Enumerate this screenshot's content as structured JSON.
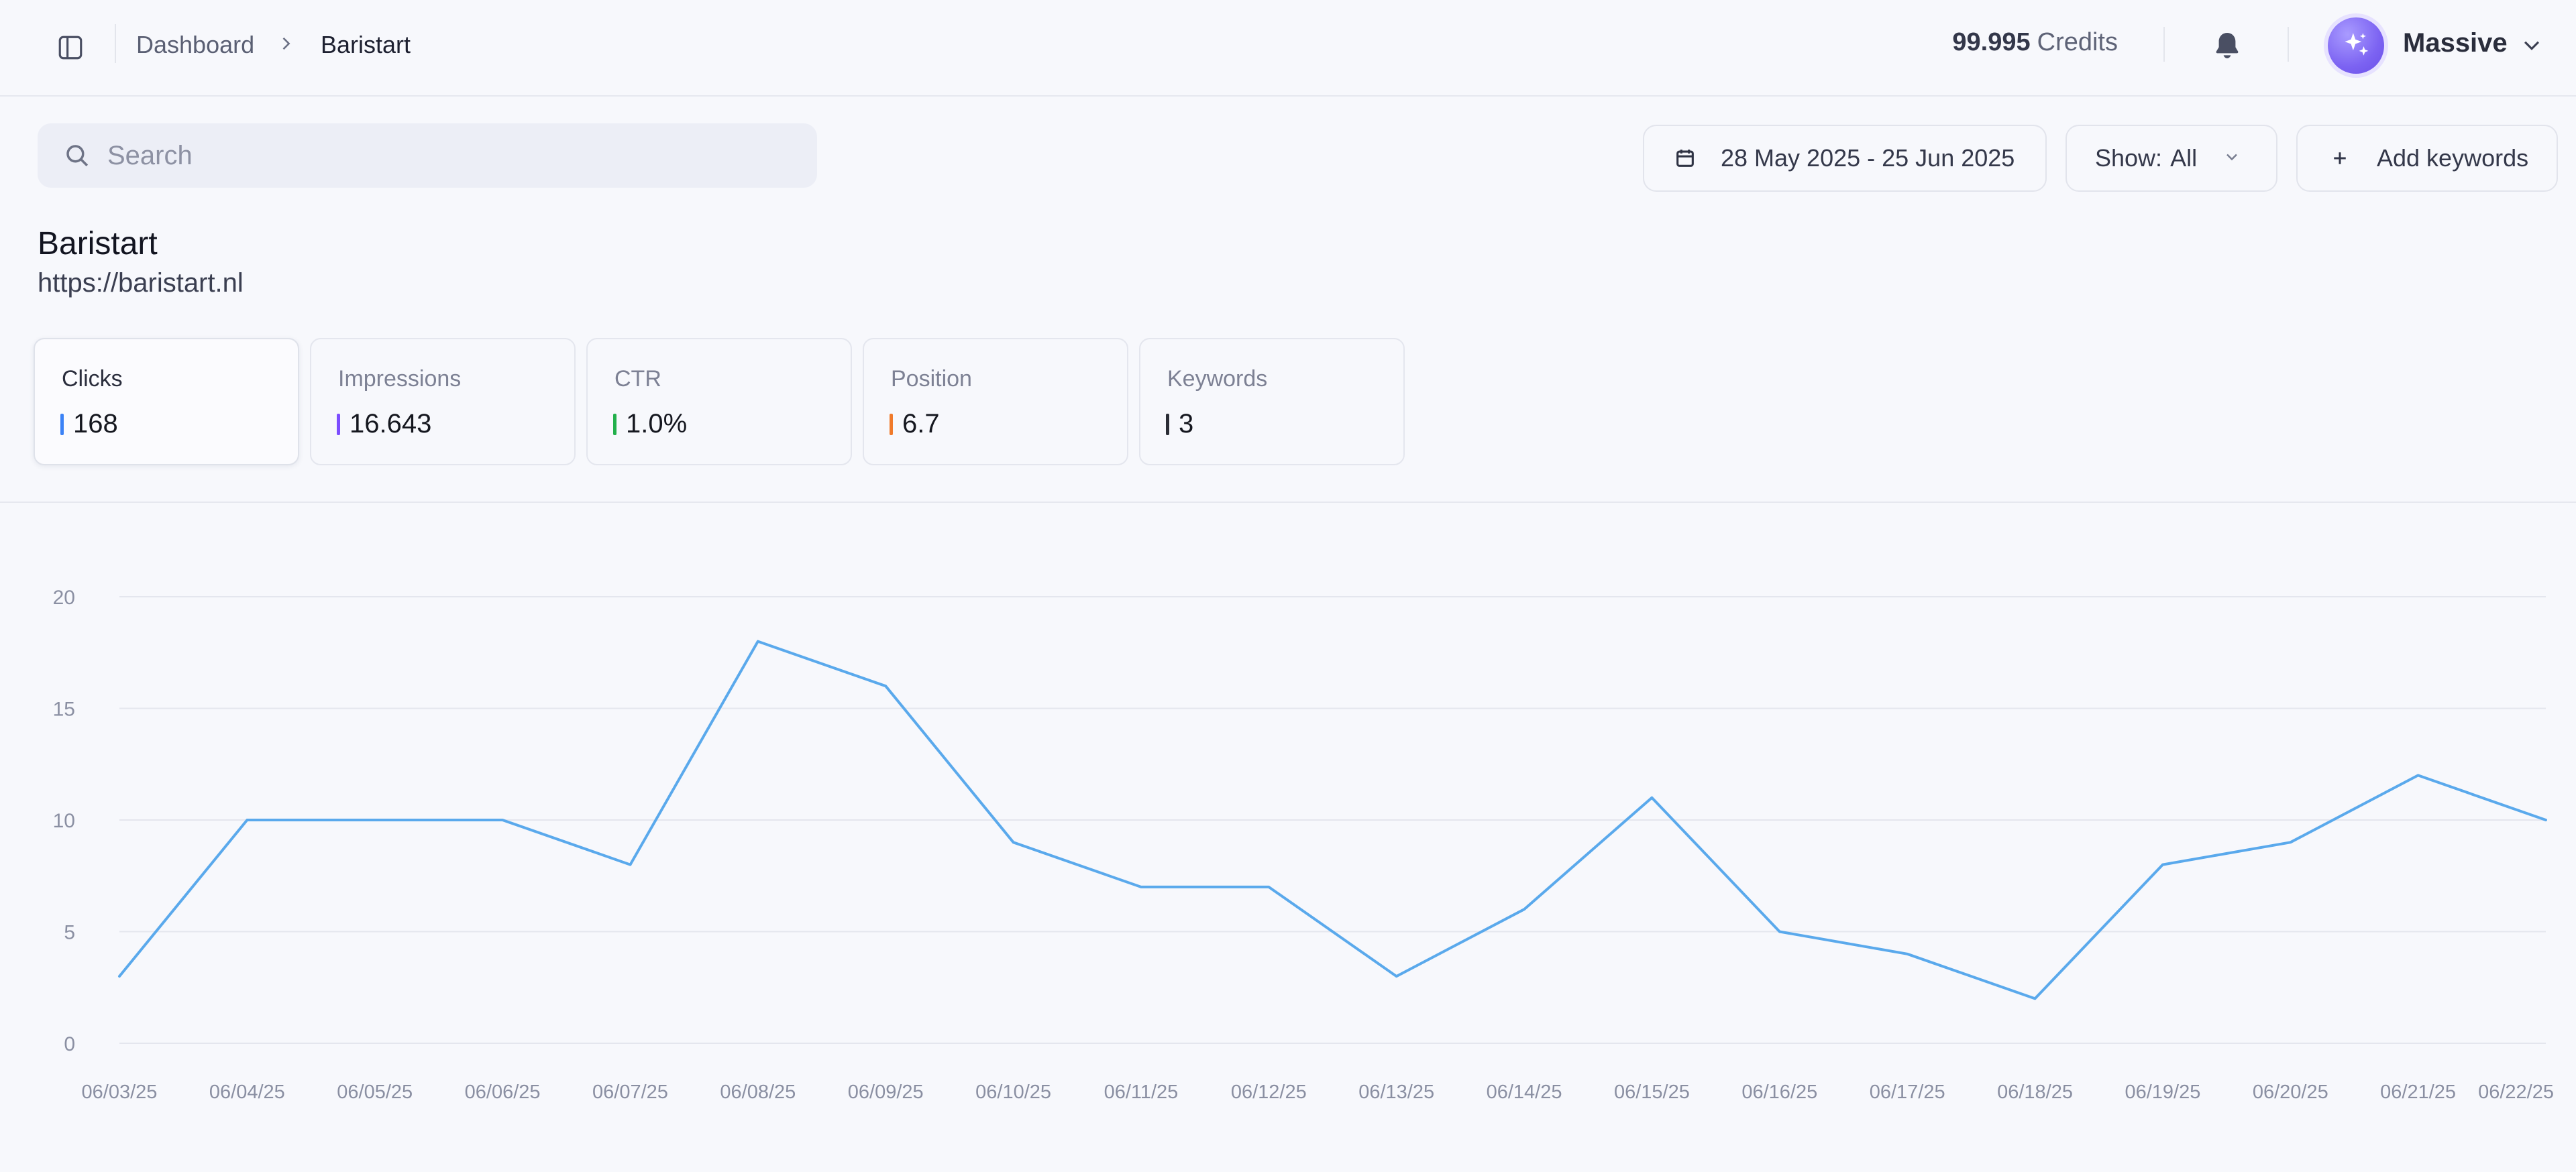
{
  "header": {
    "breadcrumb_root": "Dashboard",
    "breadcrumb_current": "Baristart",
    "credits_value": "99.995",
    "credits_label": "Credits",
    "user_name": "Massive"
  },
  "toolbar": {
    "search_placeholder": "Search",
    "date_range": "28 May 2025 - 25 Jun 2025",
    "show_label": "Show:",
    "show_value": "All",
    "add_keywords": "Add keywords"
  },
  "site": {
    "title": "Baristart",
    "url": "https://baristart.nl"
  },
  "metrics": [
    {
      "label": "Clicks",
      "value": "168",
      "color": "#3b82f6",
      "active": true
    },
    {
      "label": "Impressions",
      "value": "16.643",
      "color": "#7c4dff",
      "active": false
    },
    {
      "label": "CTR",
      "value": "1.0%",
      "color": "#22b04b",
      "active": false
    },
    {
      "label": "Position",
      "value": "6.7",
      "color": "#f07a2a",
      "active": false
    },
    {
      "label": "Keywords",
      "value": "3",
      "color": "#2b2d36",
      "active": false
    }
  ],
  "chart_data": {
    "type": "line",
    "title": "",
    "xlabel": "",
    "ylabel": "",
    "categories": [
      "06/03/25",
      "06/04/25",
      "06/05/25",
      "06/06/25",
      "06/07/25",
      "06/08/25",
      "06/09/25",
      "06/10/25",
      "06/11/25",
      "06/12/25",
      "06/13/25",
      "06/14/25",
      "06/15/25",
      "06/16/25",
      "06/17/25",
      "06/18/25",
      "06/19/25",
      "06/20/25",
      "06/21/25",
      "06/22/25"
    ],
    "values": [
      3,
      10,
      10,
      10,
      8,
      18,
      16,
      9,
      7,
      7,
      3,
      6,
      11,
      5,
      4,
      2,
      8,
      9,
      12,
      10
    ],
    "yticks": [
      0,
      5,
      10,
      15,
      20
    ],
    "ylim": [
      0,
      20
    ],
    "grid": true,
    "line_color": "#5aa9ec"
  }
}
